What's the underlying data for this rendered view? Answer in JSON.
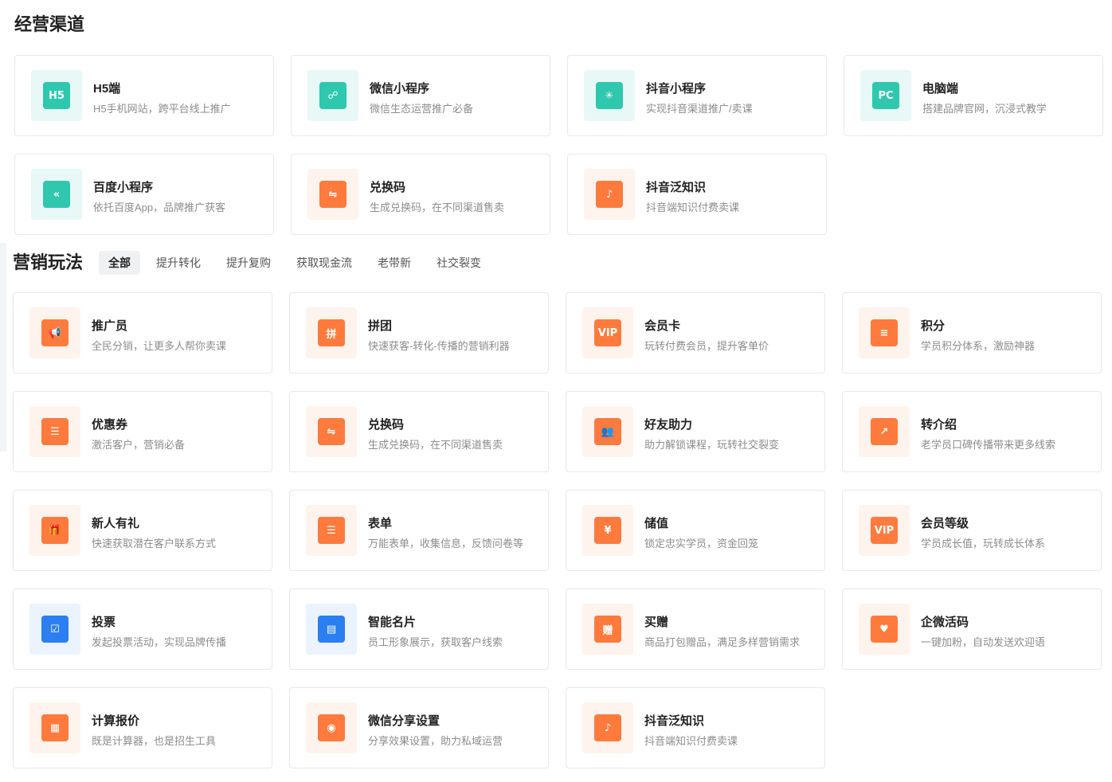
{
  "channels": {
    "title": "经营渠道",
    "items": [
      {
        "name": "H5端",
        "desc": "H5手机网站，跨平台线上推广",
        "icon": "h5-icon",
        "theme": "teal",
        "glyph": "H5"
      },
      {
        "name": "微信小程序",
        "desc": "微信生态运营推广必备",
        "icon": "wechat-miniprogram-icon",
        "theme": "teal",
        "glyph": "☍"
      },
      {
        "name": "抖音小程序",
        "desc": "实现抖音渠道推广/卖课",
        "icon": "douyin-miniprogram-icon",
        "theme": "teal",
        "glyph": "✳"
      },
      {
        "name": "电脑端",
        "desc": "搭建品牌官网，沉浸式教学",
        "icon": "pc-icon",
        "theme": "teal",
        "glyph": "PC"
      },
      {
        "name": "百度小程序",
        "desc": "依托百度App，品牌推广获客",
        "icon": "baidu-miniprogram-icon",
        "theme": "teal",
        "glyph": "«"
      },
      {
        "name": "兑换码",
        "desc": "生成兑换码，在不同渠道售卖",
        "icon": "redeem-code-icon",
        "theme": "orange",
        "glyph": "⇋"
      },
      {
        "name": "抖音泛知识",
        "desc": "抖音端知识付费卖课",
        "icon": "douyin-knowledge-icon",
        "theme": "orange",
        "glyph": "♪"
      }
    ]
  },
  "marketing": {
    "title": "营销玩法",
    "tabs": [
      "全部",
      "提升转化",
      "提升复购",
      "获取现金流",
      "老带新",
      "社交裂变"
    ],
    "active_tab": "全部",
    "items": [
      {
        "name": "推广员",
        "desc": "全民分销，让更多人帮你卖课",
        "icon": "megaphone-icon",
        "theme": "orange",
        "glyph": "📢"
      },
      {
        "name": "拼团",
        "desc": "快速获客-转化-传播的营销利器",
        "icon": "group-buy-icon",
        "theme": "orange",
        "glyph": "拼"
      },
      {
        "name": "会员卡",
        "desc": "玩转付费会员，提升客单价",
        "icon": "vip-card-icon",
        "theme": "orange",
        "glyph": "VIP"
      },
      {
        "name": "积分",
        "desc": "学员积分体系，激励神器",
        "icon": "points-icon",
        "theme": "orange",
        "glyph": "≡"
      },
      {
        "name": "优惠券",
        "desc": "激活客户，营销必备",
        "icon": "coupon-icon",
        "theme": "orange",
        "glyph": "☰"
      },
      {
        "name": "兑换码",
        "desc": "生成兑换码，在不同渠道售卖",
        "icon": "redeem-code-icon",
        "theme": "orange",
        "glyph": "⇋"
      },
      {
        "name": "好友助力",
        "desc": "助力解锁课程，玩转社交裂变",
        "icon": "friend-assist-icon",
        "theme": "orange",
        "glyph": "👥"
      },
      {
        "name": "转介绍",
        "desc": "老学员口碑传播带来更多线索",
        "icon": "referral-icon",
        "theme": "orange",
        "glyph": "↗"
      },
      {
        "name": "新人有礼",
        "desc": "快速获取潜在客户联系方式",
        "icon": "gift-icon",
        "theme": "orange",
        "glyph": "🎁"
      },
      {
        "name": "表单",
        "desc": "万能表单，收集信息，反馈问卷等",
        "icon": "form-icon",
        "theme": "orange",
        "glyph": "☰"
      },
      {
        "name": "储值",
        "desc": "锁定忠实学员，资金回笼",
        "icon": "stored-value-icon",
        "theme": "orange",
        "glyph": "¥"
      },
      {
        "name": "会员等级",
        "desc": "学员成长值，玩转成长体系",
        "icon": "member-level-icon",
        "theme": "orange",
        "glyph": "VIP"
      },
      {
        "name": "投票",
        "desc": "发起投票活动，实现品牌传播",
        "icon": "vote-icon",
        "theme": "blue",
        "glyph": "☑"
      },
      {
        "name": "智能名片",
        "desc": "员工形象展示，获取客户线索",
        "icon": "business-card-icon",
        "theme": "blue",
        "glyph": "▤"
      },
      {
        "name": "买赠",
        "desc": "商品打包赠品，满足多样营销需求",
        "icon": "buy-gift-icon",
        "theme": "orange",
        "glyph": "赠"
      },
      {
        "name": "企微活码",
        "desc": "一键加粉，自动发送欢迎语",
        "icon": "wecom-qrcode-icon",
        "theme": "orange",
        "glyph": "♥"
      },
      {
        "name": "计算报价",
        "desc": "既是计算器，也是招生工具",
        "icon": "calculator-icon",
        "theme": "orange",
        "glyph": "▦"
      },
      {
        "name": "微信分享设置",
        "desc": "分享效果设置，助力私域运营",
        "icon": "wechat-share-icon",
        "theme": "orange",
        "glyph": "◉"
      },
      {
        "name": "抖音泛知识",
        "desc": "抖音端知识付费卖课",
        "icon": "douyin-knowledge-icon",
        "theme": "orange",
        "glyph": "♪"
      }
    ]
  },
  "colors": {
    "teal_bg": "#e8f8f6",
    "teal": "#2fc7ad",
    "orange_bg": "#fff3ee",
    "orange": "#ff7a3d",
    "blue_bg": "#eaf3ff",
    "blue": "#2b7ff0"
  }
}
